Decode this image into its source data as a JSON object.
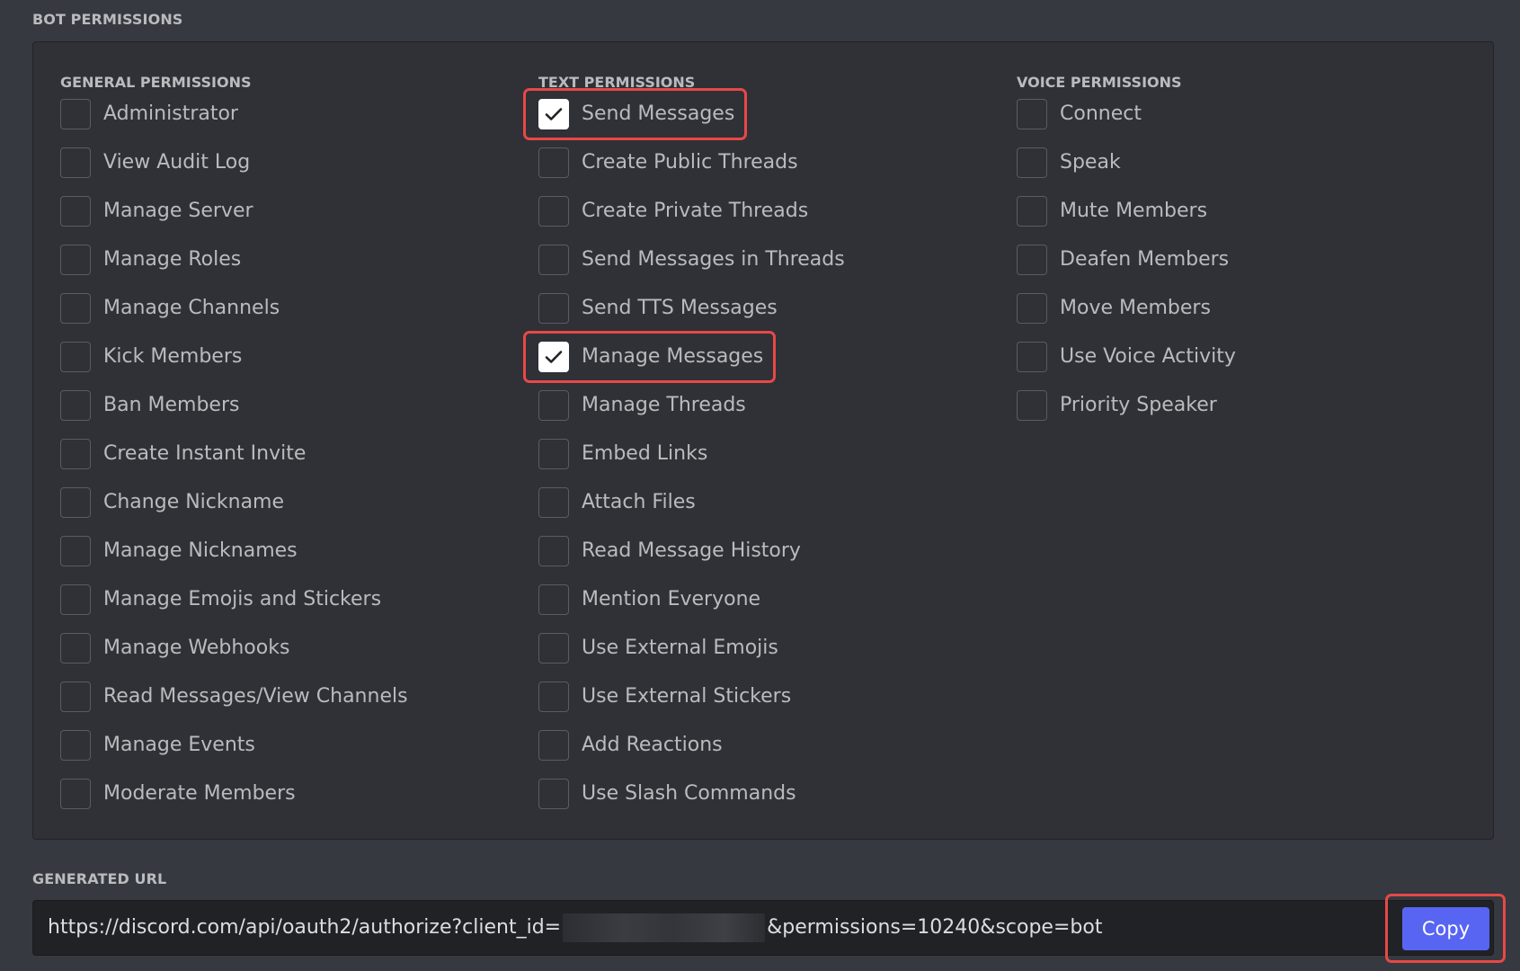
{
  "bot_permissions_title": "BOT PERMISSIONS",
  "columns": [
    {
      "title": "GENERAL PERMISSIONS",
      "items": [
        {
          "label": "Administrator",
          "checked": false
        },
        {
          "label": "View Audit Log",
          "checked": false
        },
        {
          "label": "Manage Server",
          "checked": false
        },
        {
          "label": "Manage Roles",
          "checked": false
        },
        {
          "label": "Manage Channels",
          "checked": false
        },
        {
          "label": "Kick Members",
          "checked": false
        },
        {
          "label": "Ban Members",
          "checked": false
        },
        {
          "label": "Create Instant Invite",
          "checked": false
        },
        {
          "label": "Change Nickname",
          "checked": false
        },
        {
          "label": "Manage Nicknames",
          "checked": false
        },
        {
          "label": "Manage Emojis and Stickers",
          "checked": false
        },
        {
          "label": "Manage Webhooks",
          "checked": false
        },
        {
          "label": "Read Messages/View Channels",
          "checked": false
        },
        {
          "label": "Manage Events",
          "checked": false
        },
        {
          "label": "Moderate Members",
          "checked": false
        }
      ]
    },
    {
      "title": "TEXT PERMISSIONS",
      "items": [
        {
          "label": "Send Messages",
          "checked": true,
          "highlighted": true
        },
        {
          "label": "Create Public Threads",
          "checked": false
        },
        {
          "label": "Create Private Threads",
          "checked": false
        },
        {
          "label": "Send Messages in Threads",
          "checked": false
        },
        {
          "label": "Send TTS Messages",
          "checked": false
        },
        {
          "label": "Manage Messages",
          "checked": true,
          "highlighted": true
        },
        {
          "label": "Manage Threads",
          "checked": false
        },
        {
          "label": "Embed Links",
          "checked": false
        },
        {
          "label": "Attach Files",
          "checked": false
        },
        {
          "label": "Read Message History",
          "checked": false
        },
        {
          "label": "Mention Everyone",
          "checked": false
        },
        {
          "label": "Use External Emojis",
          "checked": false
        },
        {
          "label": "Use External Stickers",
          "checked": false
        },
        {
          "label": "Add Reactions",
          "checked": false
        },
        {
          "label": "Use Slash Commands",
          "checked": false
        }
      ]
    },
    {
      "title": "VOICE PERMISSIONS",
      "items": [
        {
          "label": "Connect",
          "checked": false
        },
        {
          "label": "Speak",
          "checked": false
        },
        {
          "label": "Mute Members",
          "checked": false
        },
        {
          "label": "Deafen Members",
          "checked": false
        },
        {
          "label": "Move Members",
          "checked": false
        },
        {
          "label": "Use Voice Activity",
          "checked": false
        },
        {
          "label": "Priority Speaker",
          "checked": false
        }
      ]
    }
  ],
  "generated_url_title": "GENERATED URL",
  "generated_url": {
    "prefix": "https://discord.com/api/oauth2/authorize?client_id=",
    "suffix": "&permissions=10240&scope=bot"
  },
  "copy_button_label": "Copy",
  "colors": {
    "background": "#36393f",
    "panel": "#2f3136",
    "url_bar": "#202225",
    "accent": "#5865f2",
    "highlight": "#e84848"
  },
  "icons": {
    "checkmark": "checkmark-icon"
  }
}
